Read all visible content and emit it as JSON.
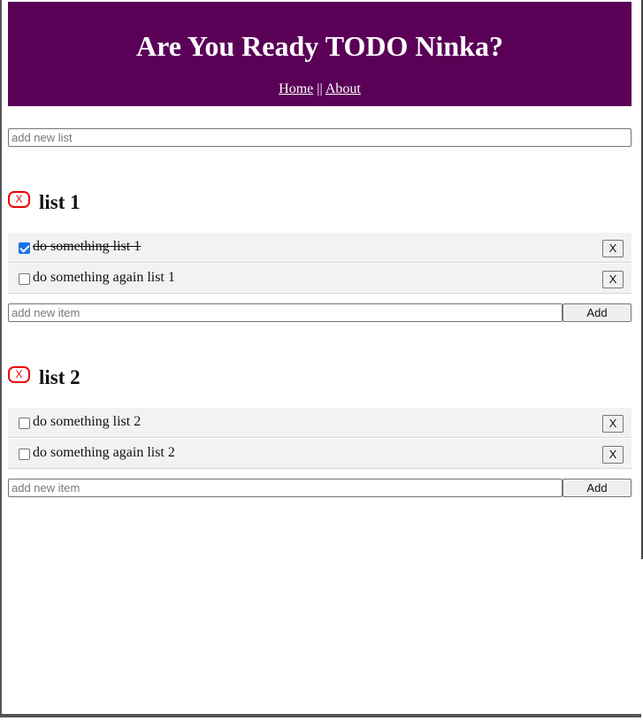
{
  "header": {
    "title": "Are You Ready TODO Ninka?",
    "nav": {
      "home": "Home",
      "separator": "||",
      "about": "About"
    }
  },
  "new_list": {
    "placeholder": "add new list",
    "value": ""
  },
  "lists": [
    {
      "delete_label": "X",
      "name": "list 1",
      "items": [
        {
          "text": "do something list 1",
          "done": true,
          "delete_label": "X"
        },
        {
          "text": "do something again list 1",
          "done": false,
          "delete_label": "X"
        }
      ],
      "new_item": {
        "placeholder": "add new item",
        "add_label": "Add"
      }
    },
    {
      "delete_label": "X",
      "name": "list 2",
      "items": [
        {
          "text": "do something list 2",
          "done": false,
          "delete_label": "X"
        },
        {
          "text": "do something again list 2",
          "done": false,
          "delete_label": "X"
        }
      ],
      "new_item": {
        "placeholder": "add new item",
        "add_label": "Add"
      }
    }
  ],
  "colors": {
    "header_bg": "#5a0057",
    "delete_list": "#ee0000",
    "item_bg": "#f2f2f2",
    "checkbox_checked": "#1a73e8"
  }
}
